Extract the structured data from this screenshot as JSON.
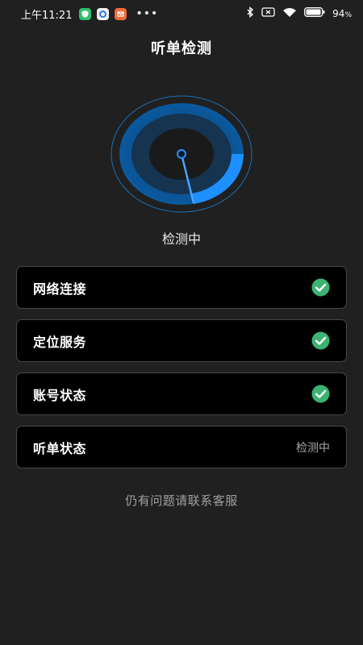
{
  "status_bar": {
    "time": "上午11:21",
    "battery": "94",
    "battery_unit": "%",
    "app_icons": [
      "shield-app-icon",
      "cloud-app-icon",
      "mail-app-icon"
    ],
    "system_icons": [
      "bluetooth-icon",
      "sim-icon",
      "wifi-icon",
      "battery-icon"
    ]
  },
  "header": {
    "title": "听单检测"
  },
  "gauge": {
    "status": "检测中",
    "accent": "#1e90ff"
  },
  "checks": [
    {
      "label": "网络连接",
      "state": "ok"
    },
    {
      "label": "定位服务",
      "state": "ok"
    },
    {
      "label": "账号状态",
      "state": "ok"
    },
    {
      "label": "听单状态",
      "state": "pending",
      "value": "检测中"
    }
  ],
  "footer": {
    "support": "仍有问题请联系客服"
  },
  "colors": {
    "background": "#202020",
    "card": "#000000",
    "check": "#3cb371"
  }
}
